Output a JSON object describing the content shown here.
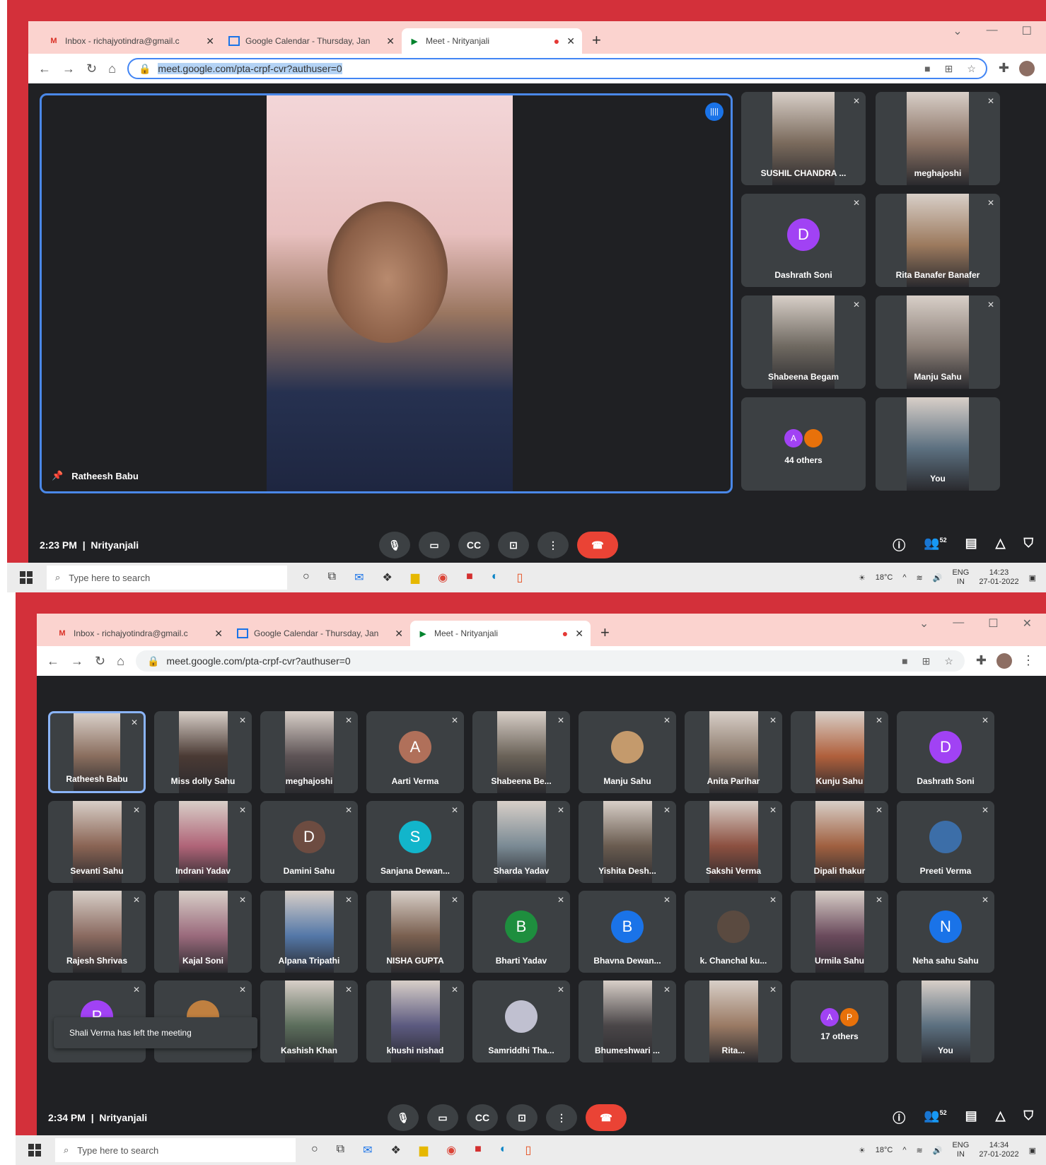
{
  "shot1": {
    "tabs": [
      {
        "title": "Inbox - richajyotindra@gmail.c",
        "icon": "gmail-icon"
      },
      {
        "title": "Google Calendar - Thursday, Jan",
        "icon": "calendar-icon"
      },
      {
        "title": "Meet - Nrityanjali",
        "icon": "meet-icon"
      }
    ],
    "url": "meet.google.com/pta-crpf-cvr?authuser=0",
    "speaker_name": "Ratheesh Babu",
    "side_tiles": [
      {
        "name": "SUSHIL CHANDRA ...",
        "type": "photo",
        "color": "#7a6a5c"
      },
      {
        "name": "meghajoshi",
        "type": "photo",
        "color": "#8a7264"
      },
      {
        "name": "Dashrath Soni",
        "type": "avatar",
        "letter": "D",
        "color": "#a142f4"
      },
      {
        "name": "Rita Banafer Banafer",
        "type": "photo",
        "color": "#9c7a5e"
      },
      {
        "name": "Shabeena Begam",
        "type": "photo",
        "color": "#6e6860"
      },
      {
        "name": "Manju Sahu",
        "type": "photo",
        "color": "#8c8078"
      },
      {
        "name": "44 others",
        "type": "others",
        "letters": [
          "A",
          ""
        ]
      },
      {
        "name": "You",
        "type": "photo",
        "color": "#5c7080"
      }
    ],
    "time": "2:23 PM",
    "meeting": "Nrityanjali",
    "participants": "52",
    "weather": "18°C",
    "lang": "ENG",
    "region": "IN",
    "clock_time": "14:23",
    "clock_date": "27-01-2022"
  },
  "shot2": {
    "tabs": [
      {
        "title": "Inbox - richajyotindra@gmail.c",
        "icon": "gmail-icon"
      },
      {
        "title": "Google Calendar - Thursday, Jan",
        "icon": "calendar-icon"
      },
      {
        "title": "Meet - Nrityanjali",
        "icon": "meet-icon"
      }
    ],
    "url": "meet.google.com/pta-crpf-cvr?authuser=0",
    "tiles": [
      {
        "name": "Ratheesh Babu",
        "type": "photo",
        "color": "#8a6e5e",
        "highlight": true
      },
      {
        "name": "Miss dolly Sahu",
        "type": "photo",
        "color": "#4a3a34"
      },
      {
        "name": "meghajoshi",
        "type": "photo",
        "color": "#5e5456"
      },
      {
        "name": "Aarti Verma",
        "type": "avatar",
        "letter": "A",
        "color": "#b0705a"
      },
      {
        "name": "Shabeena Be...",
        "type": "photo",
        "color": "#6a6258"
      },
      {
        "name": "Manju Sahu",
        "type": "avatar",
        "letter": "",
        "color": "#c49a6c"
      },
      {
        "name": "Anita Parihar",
        "type": "photo",
        "color": "#8c7a6c"
      },
      {
        "name": "Kunju Sahu",
        "type": "photo",
        "color": "#b0603c"
      },
      {
        "name": "Dashrath Soni",
        "type": "avatar",
        "letter": "D",
        "color": "#a142f4"
      },
      {
        "name": "Sevanti Sahu",
        "type": "photo",
        "color": "#8a6454"
      },
      {
        "name": "Indrani Yadav",
        "type": "photo",
        "color": "#b06478"
      },
      {
        "name": "Damini Sahu",
        "type": "avatar",
        "letter": "D",
        "color": "#6d4c41"
      },
      {
        "name": "Sanjana Dewan...",
        "type": "avatar",
        "letter": "S",
        "color": "#12b5cb"
      },
      {
        "name": "Sharda Yadav",
        "type": "photo",
        "color": "#7a8a94"
      },
      {
        "name": "Yishita Desh...",
        "type": "photo",
        "color": "#6a5c50"
      },
      {
        "name": "Sakshi Verma",
        "type": "photo",
        "color": "#8c5040"
      },
      {
        "name": "Dipali thakur",
        "type": "photo",
        "color": "#a06040"
      },
      {
        "name": "Preeti Verma",
        "type": "avatar",
        "letter": "",
        "color": "#3c6ea8"
      },
      {
        "name": "Rajesh Shrivas",
        "type": "photo",
        "color": "#8a6a60"
      },
      {
        "name": "Kajal Soni",
        "type": "photo",
        "color": "#9a6a7c"
      },
      {
        "name": "Alpana Tripathi",
        "type": "photo",
        "color": "#5478a8"
      },
      {
        "name": "NISHA GUPTA",
        "type": "photo",
        "color": "#7a6050"
      },
      {
        "name": "Bharti Yadav",
        "type": "avatar",
        "letter": "B",
        "color": "#1e8e3e"
      },
      {
        "name": "Bhavna Dewan...",
        "type": "avatar",
        "letter": "B",
        "color": "#1a73e8"
      },
      {
        "name": "k. Chanchal ku...",
        "type": "avatar",
        "letter": "",
        "color": "#5a4a40"
      },
      {
        "name": "Urmila Sahu",
        "type": "photo",
        "color": "#6a4a5c"
      },
      {
        "name": "Neha sahu Sahu",
        "type": "avatar",
        "letter": "N",
        "color": "#1a73e8"
      },
      {
        "name": "",
        "type": "avatar",
        "letter": "P",
        "color": "#a142f4"
      },
      {
        "name": "",
        "type": "avatar",
        "letter": "",
        "color": "#c08040"
      },
      {
        "name": "Kashish Khan",
        "type": "photo",
        "color": "#5c6e5c"
      },
      {
        "name": "khushi nishad",
        "type": "photo",
        "color": "#5c5a80"
      },
      {
        "name": "Samriddhi Tha...",
        "type": "avatar",
        "letter": "",
        "color": "#c0c0d0"
      },
      {
        "name": "Bhumeshwari ...",
        "type": "photo",
        "color": "#4a4648"
      },
      {
        "name": "Rita...",
        "type": "photo",
        "color": "#9a7a64"
      },
      {
        "name": "17 others",
        "type": "others",
        "letters": [
          "A",
          "P"
        ]
      },
      {
        "name": "You",
        "type": "photo",
        "color": "#5c7080"
      }
    ],
    "toast": "Shali Verma has left the meeting",
    "time": "2:34 PM",
    "meeting": "Nrityanjali",
    "participants": "52",
    "weather": "18°C",
    "lang": "ENG",
    "region": "IN",
    "clock_time": "14:34",
    "clock_date": "27-01-2022"
  },
  "search_placeholder": "Type here to search"
}
